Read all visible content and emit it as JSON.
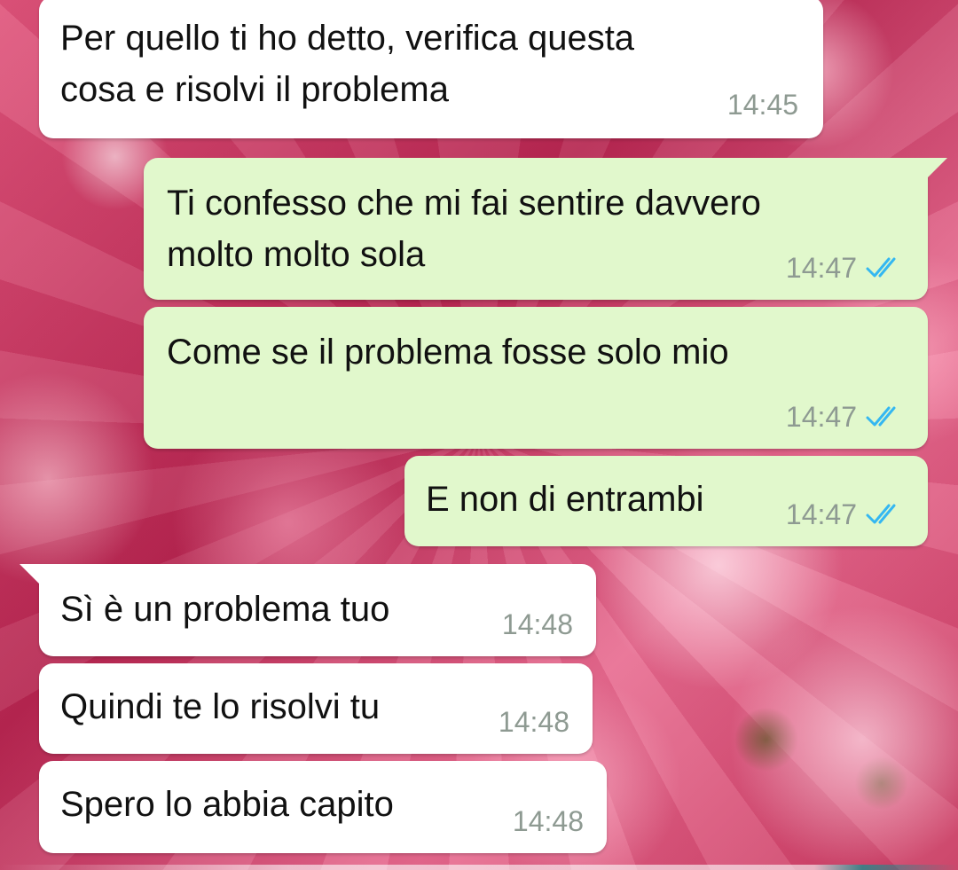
{
  "chat": {
    "messages": [
      {
        "direction": "incoming",
        "text_lines": [
          "Per quello ti ho detto, verifica questa",
          "cosa e risolvi il problema"
        ],
        "time": "14:45"
      },
      {
        "direction": "outgoing",
        "text_lines": [
          "Ti confesso che mi fai sentire davvero",
          "molto molto sola"
        ],
        "time": "14:47",
        "status": "read"
      },
      {
        "direction": "outgoing",
        "text_lines": [
          "Come se il problema fosse solo mio"
        ],
        "time": "14:47",
        "status": "read"
      },
      {
        "direction": "outgoing",
        "text_lines": [
          "E non di entrambi"
        ],
        "time": "14:47",
        "status": "read"
      },
      {
        "direction": "incoming",
        "text_lines": [
          "Sì è un problema tuo"
        ],
        "time": "14:48"
      },
      {
        "direction": "incoming",
        "text_lines": [
          "Quindi te lo risolvi tu"
        ],
        "time": "14:48"
      },
      {
        "direction": "incoming",
        "text_lines": [
          "Spero lo abbia capito"
        ],
        "time": "14:48"
      }
    ]
  },
  "icons": {
    "read_receipt": "double-check-icon"
  },
  "colors": {
    "incoming_bubble": "#ffffff",
    "outgoing_bubble": "#e1f8cc",
    "timestamp": "#8e9a92",
    "read_ticks": "#34b7f1",
    "message_text": "#111111"
  }
}
